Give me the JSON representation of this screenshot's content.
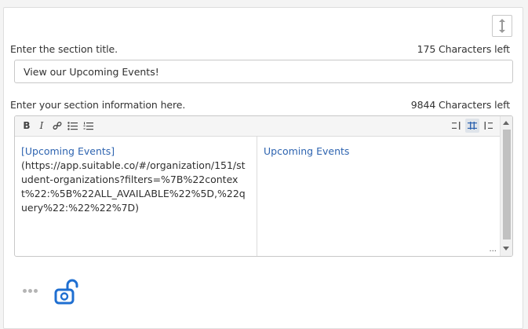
{
  "title_field": {
    "label": "Enter the section title.",
    "chars_left": "175 Characters left",
    "value": "View our Upcoming Events!"
  },
  "info_field": {
    "label": "Enter your section information here.",
    "chars_left": "9844 Characters left"
  },
  "toolbar": {
    "bold": "B",
    "italic": "I",
    "mode_selected": "split"
  },
  "editor": {
    "markdown_link_text": "[Upcoming Events]",
    "markdown_link_url": "(https://app.suitable.co/#/organization/151/student-organizations?filters=%7B%22context%22:%5B%22ALL_AVAILABLE%22%5D,%22query%22:%22%22%7D)",
    "preview_link_text": "Upcoming Events"
  },
  "colors": {
    "link": "#2e64b0",
    "icon_blue": "#1f6fd1",
    "muted_icon": "#b5b5b5"
  },
  "icons": [
    "resize-vertical-icon",
    "link-icon",
    "bullet-list-icon",
    "numbered-list-icon",
    "editor-only-icon",
    "split-view-icon",
    "preview-only-icon",
    "more-options-icon",
    "unlock-icon"
  ]
}
